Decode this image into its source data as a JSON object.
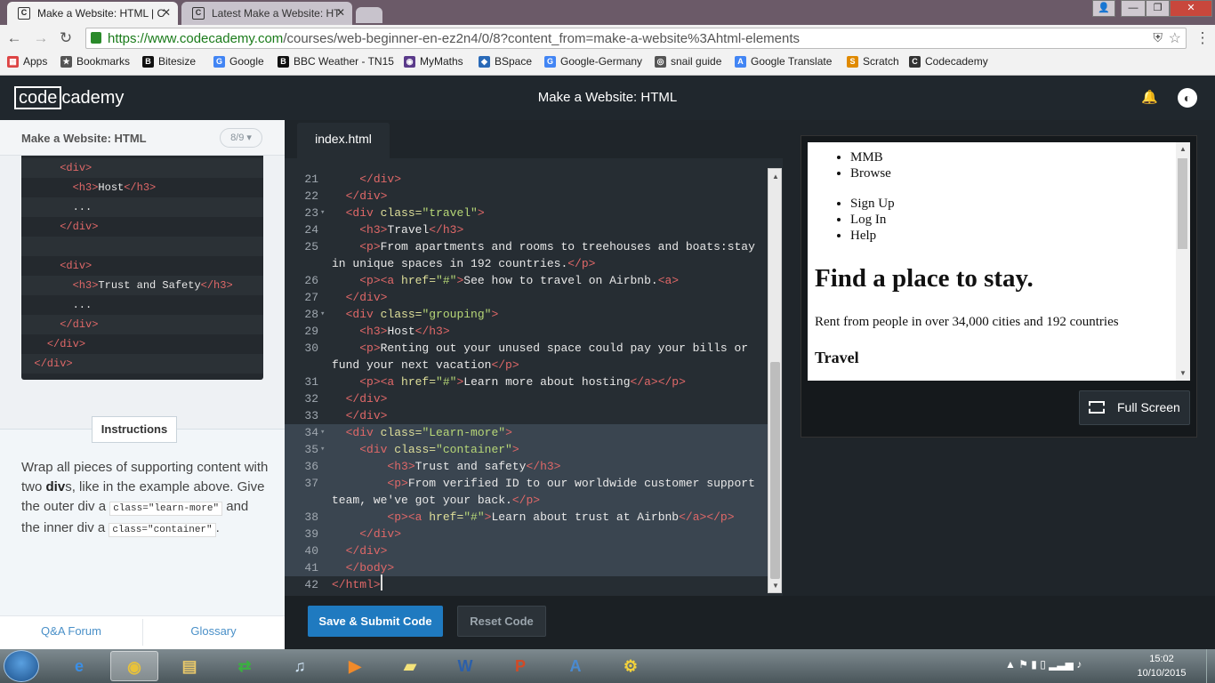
{
  "browser": {
    "tabs": [
      {
        "title": "Make a Website: HTML | C",
        "favicon": "C",
        "active": true
      },
      {
        "title": "Latest Make a Website: HT",
        "favicon": "C",
        "active": false
      }
    ],
    "close_glyph": "✕",
    "window_buttons": {
      "user": "👤",
      "minimize": "—",
      "maximize": "❐",
      "close": "✕"
    },
    "nav": {
      "back": "←",
      "forward": "→",
      "reload": "↻",
      "menu": "⋮",
      "star": "☆",
      "shield": "⛨"
    },
    "url_host": "https://www.codecademy.com",
    "url_path": "/courses/web-beginner-en-ez2n4/0/8?content_from=make-a-website%3Ahtml-elements",
    "bookmarks": [
      "Apps",
      "Bookmarks",
      "Bitesize",
      "Google",
      "BBC Weather - TN15",
      "MyMaths",
      "BSpace",
      "Google-Germany",
      "snail guide",
      "Google Translate",
      "Scratch",
      "Codecademy"
    ],
    "bookmark_icons": [
      "▦",
      "★",
      "B",
      "G",
      "B",
      "◉",
      "◆",
      "G",
      "◎",
      "A",
      "S",
      "C"
    ],
    "bookmark_colors": [
      "#d44",
      "#555",
      "#111",
      "#4285f4",
      "#111",
      "#5a3a8a",
      "#2a6ab8",
      "#4285f4",
      "#555",
      "#4285f4",
      "#e08a00",
      "#333"
    ]
  },
  "header": {
    "logo_box": "code",
    "logo_rest": "cademy",
    "course_title": "Make a Website: HTML",
    "bell_icon": "🔔",
    "avatar_icon": "◐"
  },
  "lesson": {
    "title": "Make a Website: HTML",
    "count": "8/9 ▾"
  },
  "example_code": [
    {
      "indent": "    ",
      "parts": [
        [
          "tag",
          "<div>"
        ]
      ]
    },
    {
      "indent": "      ",
      "parts": [
        [
          "tag",
          "<h3>"
        ],
        [
          "txt",
          "Host"
        ],
        [
          "tag",
          "</h3>"
        ]
      ]
    },
    {
      "indent": "      ",
      "parts": [
        [
          "txt",
          "..."
        ]
      ]
    },
    {
      "indent": "    ",
      "parts": [
        [
          "tag",
          "</div>"
        ]
      ]
    },
    {
      "indent": "",
      "parts": []
    },
    {
      "indent": "    ",
      "parts": [
        [
          "tag",
          "<div>"
        ]
      ]
    },
    {
      "indent": "      ",
      "parts": [
        [
          "tag",
          "<h3>"
        ],
        [
          "txt",
          "Trust and Safety"
        ],
        [
          "tag",
          "</h3>"
        ]
      ]
    },
    {
      "indent": "      ",
      "parts": [
        [
          "txt",
          "..."
        ]
      ]
    },
    {
      "indent": "    ",
      "parts": [
        [
          "tag",
          "</div>"
        ]
      ]
    },
    {
      "indent": "  ",
      "parts": [
        [
          "tag",
          "</div>"
        ]
      ]
    },
    {
      "indent": "",
      "parts": [
        [
          "tag",
          "</div>"
        ]
      ]
    }
  ],
  "instructions": {
    "tab_label": "Instructions",
    "text_1": "Wrap all pieces of supporting content with two ",
    "text_bold": "div",
    "text_2": "s, like in the example above. Give the outer div a ",
    "code_1": "class=\"learn-more\"",
    "text_3": " and the inner div a ",
    "code_2": "class=\"container\"",
    "text_4": "."
  },
  "footer": {
    "qa": "Q&A Forum",
    "glossary": "Glossary"
  },
  "editor": {
    "file_tab": "index.html",
    "lines": [
      {
        "n": "21",
        "fold": "",
        "sel": false,
        "parts": [
          [
            "txt",
            "    "
          ],
          [
            "tag",
            "</div>"
          ]
        ]
      },
      {
        "n": "22",
        "fold": "",
        "sel": false,
        "parts": [
          [
            "txt",
            "  "
          ],
          [
            "tag",
            "</div>"
          ]
        ]
      },
      {
        "n": "23",
        "fold": "▾",
        "sel": false,
        "parts": [
          [
            "txt",
            "  "
          ],
          [
            "tag",
            "<div "
          ],
          [
            "attr",
            "class="
          ],
          [
            "str",
            "\"travel\""
          ],
          [
            "tag",
            ">"
          ]
        ]
      },
      {
        "n": "24",
        "fold": "",
        "sel": false,
        "parts": [
          [
            "txt",
            "    "
          ],
          [
            "tag",
            "<h3>"
          ],
          [
            "txt",
            "Travel"
          ],
          [
            "tag",
            "</h3>"
          ]
        ]
      },
      {
        "n": "25",
        "fold": "",
        "sel": false,
        "parts": [
          [
            "txt",
            "    "
          ],
          [
            "tag",
            "<p>"
          ],
          [
            "txt",
            "From apartments and rooms to treehouses and boats:stay"
          ]
        ]
      },
      {
        "n": "",
        "fold": "",
        "sel": false,
        "parts": [
          [
            "txt",
            "in unique spaces in 192 countries."
          ],
          [
            "tag",
            "</p>"
          ]
        ]
      },
      {
        "n": "26",
        "fold": "",
        "sel": false,
        "parts": [
          [
            "txt",
            "    "
          ],
          [
            "tag",
            "<p><a "
          ],
          [
            "attr",
            "href="
          ],
          [
            "str",
            "\"#\""
          ],
          [
            "tag",
            ">"
          ],
          [
            "txt",
            "See how to travel on Airbnb."
          ],
          [
            "tag",
            "<a>"
          ]
        ]
      },
      {
        "n": "27",
        "fold": "",
        "sel": false,
        "parts": [
          [
            "txt",
            "  "
          ],
          [
            "tag",
            "</div>"
          ]
        ]
      },
      {
        "n": "28",
        "fold": "▾",
        "sel": false,
        "parts": [
          [
            "txt",
            "  "
          ],
          [
            "tag",
            "<div "
          ],
          [
            "attr",
            "class="
          ],
          [
            "str",
            "\"grouping\""
          ],
          [
            "tag",
            ">"
          ]
        ]
      },
      {
        "n": "29",
        "fold": "",
        "sel": false,
        "parts": [
          [
            "txt",
            "    "
          ],
          [
            "tag",
            "<h3>"
          ],
          [
            "txt",
            "Host"
          ],
          [
            "tag",
            "</h3>"
          ]
        ]
      },
      {
        "n": "30",
        "fold": "",
        "sel": false,
        "parts": [
          [
            "txt",
            "    "
          ],
          [
            "tag",
            "<p>"
          ],
          [
            "txt",
            "Renting out your unused space could pay your bills or"
          ]
        ]
      },
      {
        "n": "",
        "fold": "",
        "sel": false,
        "parts": [
          [
            "txt",
            "fund your next vacation"
          ],
          [
            "tag",
            "</p>"
          ]
        ]
      },
      {
        "n": "31",
        "fold": "",
        "sel": false,
        "parts": [
          [
            "txt",
            "    "
          ],
          [
            "tag",
            "<p><a "
          ],
          [
            "attr",
            "href="
          ],
          [
            "str",
            "\"#\""
          ],
          [
            "tag",
            ">"
          ],
          [
            "txt",
            "Learn more about hosting"
          ],
          [
            "tag",
            "</a></p>"
          ]
        ]
      },
      {
        "n": "32",
        "fold": "",
        "sel": false,
        "parts": [
          [
            "txt",
            "  "
          ],
          [
            "tag",
            "</div>"
          ]
        ]
      },
      {
        "n": "33",
        "fold": "",
        "sel": false,
        "parts": [
          [
            "txt",
            "  "
          ],
          [
            "tag",
            "</div>"
          ]
        ]
      },
      {
        "n": "34",
        "fold": "▾",
        "sel": true,
        "parts": [
          [
            "txt",
            "  "
          ],
          [
            "tag",
            "<div "
          ],
          [
            "attr",
            "class="
          ],
          [
            "str",
            "\"Learn-more\""
          ],
          [
            "tag",
            ">"
          ]
        ]
      },
      {
        "n": "35",
        "fold": "▾",
        "sel": true,
        "parts": [
          [
            "txt",
            "    "
          ],
          [
            "tag",
            "<div "
          ],
          [
            "attr",
            "class="
          ],
          [
            "str",
            "\"container\""
          ],
          [
            "tag",
            ">"
          ]
        ]
      },
      {
        "n": "36",
        "fold": "",
        "sel": true,
        "parts": [
          [
            "txt",
            "        "
          ],
          [
            "tag",
            "<h3>"
          ],
          [
            "txt",
            "Trust and safety"
          ],
          [
            "tag",
            "</h3>"
          ]
        ]
      },
      {
        "n": "37",
        "fold": "",
        "sel": true,
        "parts": [
          [
            "txt",
            "        "
          ],
          [
            "tag",
            "<p>"
          ],
          [
            "txt",
            "From verified ID to our worldwide customer support"
          ]
        ]
      },
      {
        "n": "",
        "fold": "",
        "sel": true,
        "parts": [
          [
            "txt",
            "team, we've got your back."
          ],
          [
            "tag",
            "</p>"
          ]
        ]
      },
      {
        "n": "38",
        "fold": "",
        "sel": true,
        "parts": [
          [
            "txt",
            "        "
          ],
          [
            "tag",
            "<p><a "
          ],
          [
            "attr",
            "href="
          ],
          [
            "str",
            "\"#\""
          ],
          [
            "tag",
            ">"
          ],
          [
            "txt",
            "Learn about trust at Airbnb"
          ],
          [
            "tag",
            "</a></p>"
          ]
        ]
      },
      {
        "n": "39",
        "fold": "",
        "sel": true,
        "parts": [
          [
            "txt",
            "    "
          ],
          [
            "tag",
            "</div>"
          ]
        ]
      },
      {
        "n": "40",
        "fold": "",
        "sel": true,
        "parts": [
          [
            "txt",
            "  "
          ],
          [
            "tag",
            "</div>"
          ]
        ]
      },
      {
        "n": "41",
        "fold": "",
        "sel": true,
        "parts": [
          [
            "txt",
            "  "
          ],
          [
            "tag",
            "</body>"
          ]
        ]
      },
      {
        "n": "42",
        "fold": "",
        "sel": false,
        "parts": [
          [
            "tag",
            "</html>"
          ]
        ]
      }
    ]
  },
  "buttons": {
    "save": "Save & Submit Code",
    "reset": "Reset Code",
    "fullscreen": "Full Screen"
  },
  "preview": {
    "list1": [
      "MMB",
      "Browse"
    ],
    "list2": [
      "Sign Up",
      "Log In",
      "Help"
    ],
    "h1": "Find a place to stay.",
    "p": "Rent from people in over 34,000 cities and 192 countries",
    "h3": "Travel"
  },
  "taskbar": {
    "apps": [
      {
        "name": "internet-explorer",
        "glyph": "e",
        "color": "#3a8ee6",
        "active": false
      },
      {
        "name": "chrome",
        "glyph": "◉",
        "color": "#e8c23a",
        "active": true
      },
      {
        "name": "file-explorer",
        "glyph": "▤",
        "color": "#e8c86a",
        "active": false
      },
      {
        "name": "green-arrows",
        "glyph": "⇄",
        "color": "#3ab040",
        "active": false
      },
      {
        "name": "itunes",
        "glyph": "♫",
        "color": "#cfe4f6",
        "active": false
      },
      {
        "name": "media-player",
        "glyph": "▶",
        "color": "#f08a2a",
        "active": false
      },
      {
        "name": "sticky-notes",
        "glyph": "▰",
        "color": "#f4e37a",
        "active": false
      },
      {
        "name": "word",
        "glyph": "W",
        "color": "#2b5faa",
        "active": false
      },
      {
        "name": "powerpoint",
        "glyph": "P",
        "color": "#d24a26",
        "active": false
      },
      {
        "name": "publisher",
        "glyph": "A",
        "color": "#4a8ad0",
        "active": false
      },
      {
        "name": "python",
        "glyph": "⚙",
        "color": "#f5d33a",
        "active": false
      }
    ],
    "tray": "▲  ⚑  ▮  ▯  ▂▃▅  ♪",
    "time": "15:02",
    "date": "10/10/2015"
  }
}
